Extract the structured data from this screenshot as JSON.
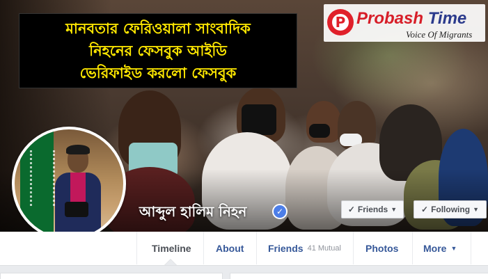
{
  "headline": {
    "lines": [
      "মানবতার ফেরিওয়ালা সাংবাদিক",
      "নিহনের ফেসবুক আইডি",
      "ভেরিফাইড করলো ফেসবুক"
    ]
  },
  "logo": {
    "letter": "P",
    "name_part1": "Probash",
    "name_part2": " Time",
    "tagline": "Voice Of Migrants"
  },
  "profile": {
    "name": "আব্দুল হালিম নিহন",
    "verified_mark": "✓"
  },
  "actions": {
    "friends_label": "Friends",
    "following_label": "Following",
    "check": "✓",
    "caret": "▼"
  },
  "nav": {
    "tabs": [
      {
        "label": "Timeline"
      },
      {
        "label": "About"
      },
      {
        "label": "Friends",
        "extra": "41 Mutual"
      },
      {
        "label": "Photos"
      },
      {
        "label": "More",
        "caret": "▼"
      }
    ]
  },
  "colors": {
    "headline_text": "#ffe800",
    "link_blue": "#365899",
    "verified_blue": "#4c7ee8",
    "logo_red": "#d71e28"
  }
}
